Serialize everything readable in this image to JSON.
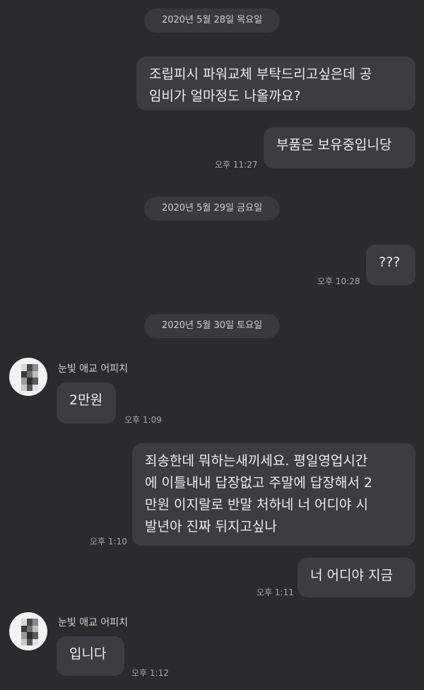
{
  "dates": [
    "2020년 5월 28일 목요일",
    "2020년 5월 29일 금요일",
    "2020년 5월 30일 토요일"
  ],
  "messages": [
    {
      "side": "out",
      "text": "조립피시 파워교체 부탁드리고싶은데 공\n임비가 얼마정도 나올까요?",
      "time": ""
    },
    {
      "side": "out",
      "text": "부품은 보유중입니당",
      "time": "오후 11:27"
    },
    {
      "side": "out",
      "text": "???",
      "time": "오후 10:28"
    },
    {
      "side": "in",
      "sender": "눈빛 애교 어피치",
      "text": "2만원",
      "time": "오후 1:09"
    },
    {
      "side": "out",
      "text": "죄송한데 뭐하는새끼세요. 평일영업시간\n에 이틀내내 답장없고 주말에 답장해서 2\n만원 이지랄로 반말 처하네 너 어디야 시\n발년아 진짜 뒤지고싶나",
      "time": "오후 1:10"
    },
    {
      "side": "out",
      "text": "너 어디야 지금",
      "time": "오후 1:11"
    },
    {
      "side": "in",
      "sender": "눈빛 애교 어피치",
      "text": "입니다",
      "time": "오후 1:12"
    }
  ],
  "colors": {
    "background": "#2b2b2d",
    "bubble": "#3d3d41",
    "date_pill": "#3a3a3e",
    "avatar_bg": "#f2f2f2"
  },
  "icons": {
    "avatar": "pixelated-profile-icon"
  }
}
